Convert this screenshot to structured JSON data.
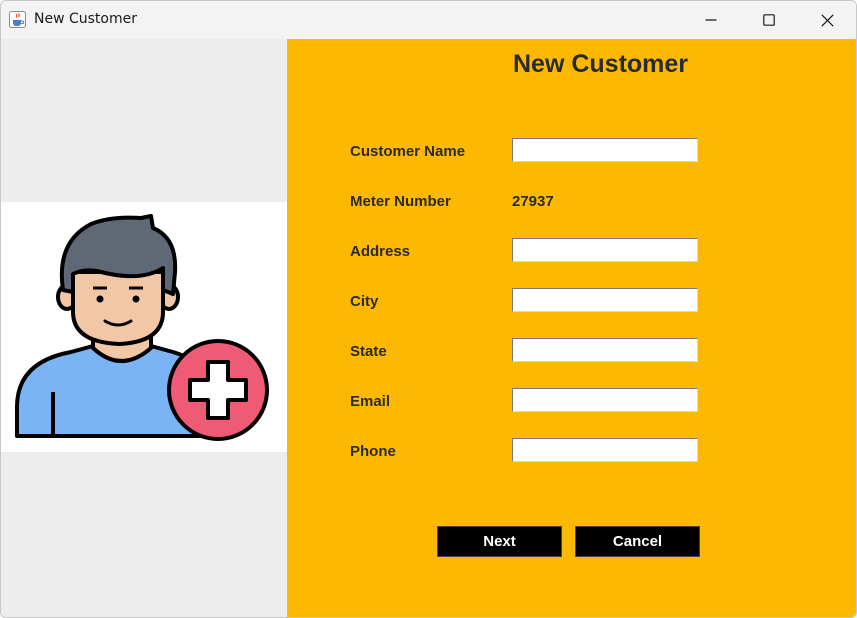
{
  "window": {
    "title": "New Customer",
    "icon": "java-cup-icon",
    "controls": [
      "minimize-icon",
      "maximize-icon",
      "close-icon"
    ]
  },
  "illustration": {
    "icon": "add-user-icon",
    "colors": {
      "shirt": "#7ab4f5",
      "hair": "#5f6875",
      "skin": "#f2c7a5",
      "plus_badge": "#ef5b74"
    }
  },
  "form": {
    "heading": "New Customer",
    "fields": [
      {
        "label": "Customer Name",
        "type": "input",
        "value": ""
      },
      {
        "label": "Meter Number",
        "type": "text",
        "value": "27937"
      },
      {
        "label": "Address",
        "type": "input",
        "value": ""
      },
      {
        "label": "City",
        "type": "input",
        "value": ""
      },
      {
        "label": "State",
        "type": "input",
        "value": ""
      },
      {
        "label": "Email",
        "type": "input",
        "value": ""
      },
      {
        "label": "Phone",
        "type": "input",
        "value": ""
      }
    ],
    "buttons": {
      "next": "Next",
      "cancel": "Cancel"
    }
  },
  "colors": {
    "panel_bg": "#fdb902",
    "button_bg": "#000000",
    "button_text": "#ffffff"
  }
}
